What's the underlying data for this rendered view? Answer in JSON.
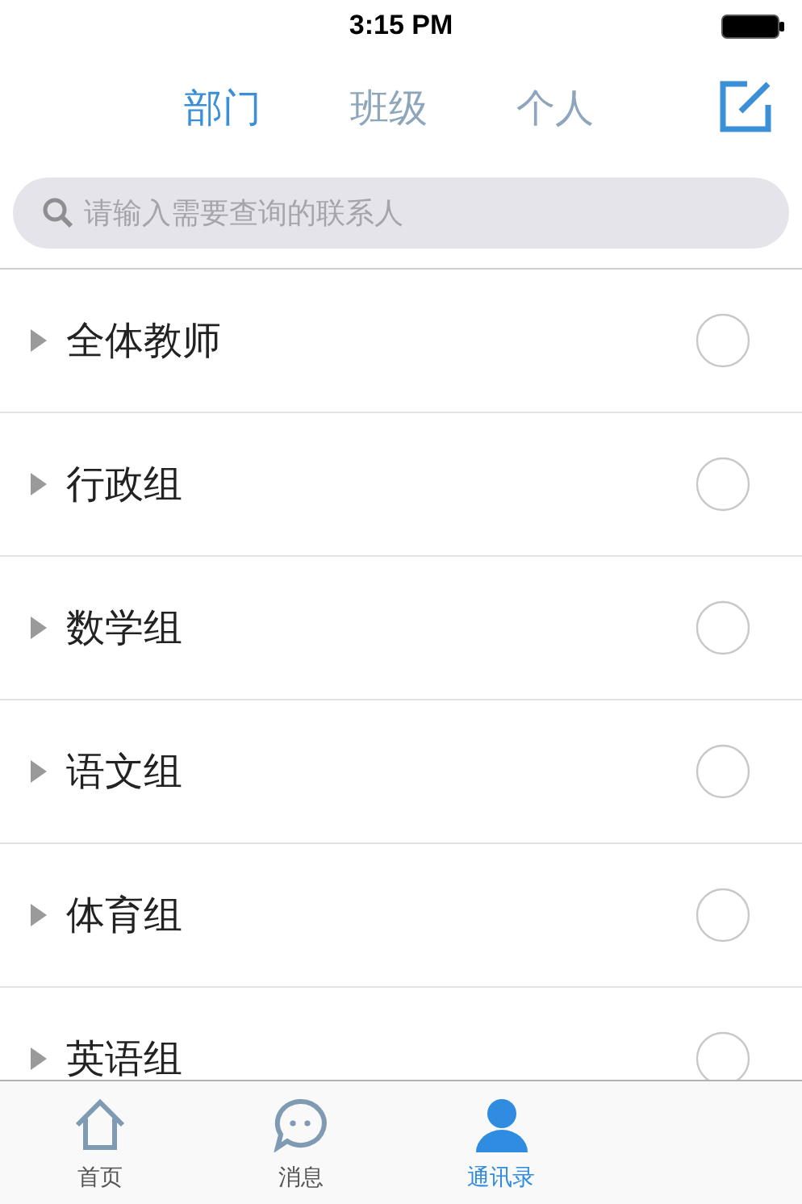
{
  "status_bar": {
    "time": "3:15 PM"
  },
  "segments": [
    {
      "label": "部门",
      "selected": true
    },
    {
      "label": "班级",
      "selected": false
    },
    {
      "label": "个人",
      "selected": false
    }
  ],
  "search": {
    "placeholder": "请输入需要查询的联系人"
  },
  "groups": [
    {
      "name": "全体教师",
      "expanded": false,
      "checked": false
    },
    {
      "name": "行政组",
      "expanded": false,
      "checked": false
    },
    {
      "name": "数学组",
      "expanded": false,
      "checked": false
    },
    {
      "name": "语文组",
      "expanded": false,
      "checked": false
    },
    {
      "name": "体育组",
      "expanded": false,
      "checked": false
    },
    {
      "name": "英语组",
      "expanded": false,
      "checked": false
    }
  ],
  "tab_bar": [
    {
      "label": "首页",
      "kind": "home",
      "selected": false
    },
    {
      "label": "消息",
      "kind": "chat",
      "selected": false
    },
    {
      "label": "通讯录",
      "kind": "contacts",
      "selected": true
    }
  ]
}
